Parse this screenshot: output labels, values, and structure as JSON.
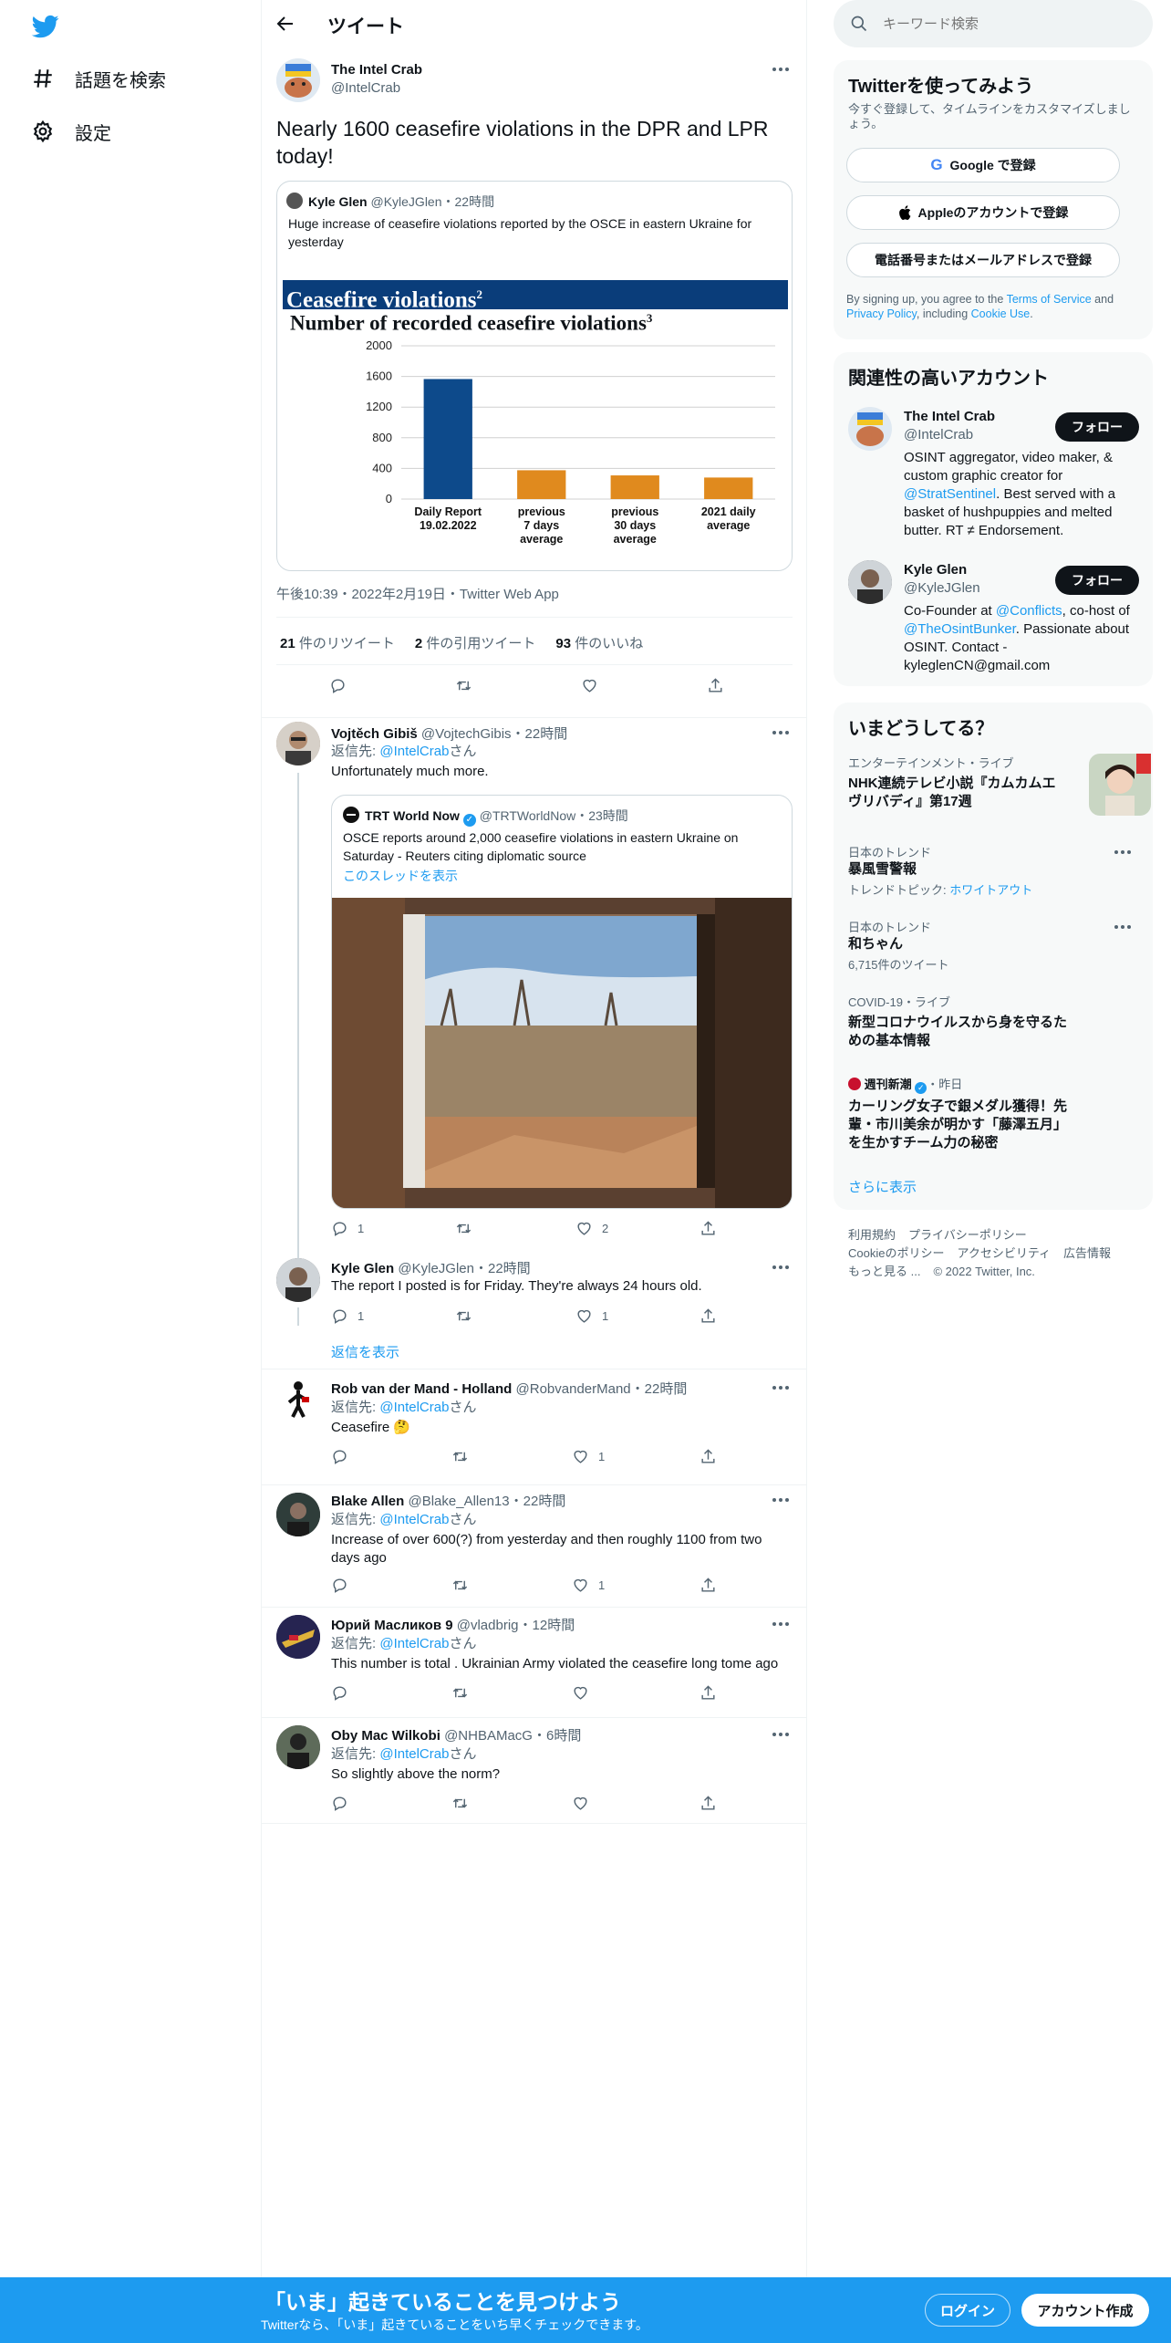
{
  "nav": {
    "explore_label": "話題を検索",
    "settings_label": "設定"
  },
  "header": {
    "title": "ツイート"
  },
  "tweet": {
    "author_name": "The Intel Crab",
    "author_handle": "@IntelCrab",
    "text": "Nearly 1600 ceasefire violations in the DPR and LPR today!",
    "quoted": {
      "author_name": "Kyle Glen",
      "author_handle": "@KyleJGlen",
      "time": "22時間",
      "text": "Huge increase of ceasefire violations reported by the OSCE in eastern Ukraine for yesterday",
      "image_banner": "Ceasefire violations",
      "image_banner_sup": "2",
      "image_subtitle": "Number of recorded ceasefire violations",
      "image_subtitle_sup": "3"
    },
    "meta": "午後10:39・2022年2月19日・Twitter Web App",
    "stats": {
      "retweets_count": "21",
      "retweets_label": " 件のリツイート",
      "quotes_count": "2",
      "quotes_label": " 件の引用ツイート",
      "likes_count": "93",
      "likes_label": " 件のいいね"
    }
  },
  "chart_data": {
    "type": "bar",
    "title": "Number of recorded ceasefire violations",
    "categories": [
      "Daily Report\n19.02.2022",
      "previous\n7 days\naverage",
      "previous\n30 days\naverage",
      "2021 daily\naverage"
    ],
    "category_lines": [
      [
        "Daily Report",
        "19.02.2022"
      ],
      [
        "previous",
        "7 days",
        "average"
      ],
      [
        "previous",
        "30 days",
        "average"
      ],
      [
        "2021 daily",
        "average"
      ]
    ],
    "values": [
      1566,
      376,
      309,
      281
    ],
    "colors": [
      "#0d4a8b",
      "#e08a1e",
      "#e08a1e",
      "#e08a1e"
    ],
    "yticks": [
      "2000",
      "1600",
      "1200",
      "800",
      "400",
      "0"
    ],
    "ylim": [
      0,
      2000
    ],
    "grid": true
  },
  "replies": [
    {
      "name": "Vojtěch Gibiš",
      "handle": "@VojtechGibis",
      "time": "22時間",
      "reply_prefix": "返信先: ",
      "reply_to": "@IntelCrab",
      "reply_suffix": "さん",
      "text": "Unfortunately much more.",
      "embed": {
        "name": "TRT World Now",
        "handle": "@TRTWorldNow",
        "time": "23時間",
        "text": "OSCE reports around 2,000 ceasefire violations in eastern Ukraine on Saturday - Reuters citing diplomatic source",
        "thread_link": "このスレッドを表示"
      },
      "reply_count": "1",
      "retweet_count": "",
      "like_count": "2"
    },
    {
      "name": "Kyle Glen",
      "handle": "@KyleJGlen",
      "time": "22時間",
      "text": "The report I posted is for Friday. They're always 24 hours old.",
      "reply_count": "1",
      "retweet_count": "",
      "like_count": "1",
      "show_replies": "返信を表示"
    },
    {
      "name": "Rob van der Mand - Holland",
      "handle": "@RobvanderMand",
      "time": "22時間",
      "reply_prefix": "返信先: ",
      "reply_to": "@IntelCrab",
      "reply_suffix": "さん",
      "text": "Ceasefire 🤔",
      "reply_count": "",
      "retweet_count": "",
      "like_count": "1"
    },
    {
      "name": "Blake Allen",
      "handle": "@Blake_Allen13",
      "time": "22時間",
      "reply_prefix": "返信先: ",
      "reply_to": "@IntelCrab",
      "reply_suffix": "さん",
      "text": "Increase of over 600(?) from yesterday and then roughly 1100 from two days ago",
      "reply_count": "",
      "retweet_count": "",
      "like_count": "1"
    },
    {
      "name": "Юрий Масликов 9",
      "handle": "@vladbrig",
      "time": "12時間",
      "reply_prefix": "返信先: ",
      "reply_to": "@IntelCrab",
      "reply_suffix": "さん",
      "text": "This number is total . Ukrainian Army violated the ceasefire long tome ago",
      "reply_count": "",
      "retweet_count": "",
      "like_count": ""
    },
    {
      "name": "Oby Mac Wilkobi",
      "handle": "@NHBAMacG",
      "time": "6時間",
      "reply_prefix": "返信先: ",
      "reply_to": "@IntelCrab",
      "reply_suffix": "さん",
      "text": "So slightly above the norm?",
      "reply_count": "",
      "retweet_count": "",
      "like_count": ""
    }
  ],
  "search": {
    "placeholder": "キーワード検索"
  },
  "signup": {
    "title": "Twitterを使ってみよう",
    "subtitle": "今すぐ登録して、タイムラインをカスタマイズしましょう。",
    "google": "Google で登録",
    "apple": "Appleのアカウントで登録",
    "phone": "電話番号またはメールアドレスで登録",
    "legal_1": "By signing up, you agree to the ",
    "tos": "Terms of Service",
    "legal_2": " and ",
    "privacy": "Privacy Policy",
    "legal_3": ", including ",
    "cookie": "Cookie Use",
    "legal_4": "."
  },
  "related": {
    "title": "関連性の高いアカウント",
    "follow_label": "フォロー",
    "accounts": [
      {
        "name": "The Intel Crab",
        "handle": "@IntelCrab",
        "bio_1": "OSINT aggregator, video maker, & custom graphic creator for ",
        "bio_link": "@StratSentinel",
        "bio_2": ". Best served with a basket of hushpuppies and melted butter. RT ≠ Endorsement."
      },
      {
        "name": "Kyle Glen",
        "handle": "@KyleJGlen",
        "bio_1": "Co-Founder at ",
        "bio_link": "@Conflicts",
        "bio_2": ", co-host of ",
        "bio_link2": "@TheOsintBunker",
        "bio_3": ". Passionate about OSINT. Contact - kyleglenCN@gmail.com"
      }
    ]
  },
  "trends": {
    "title": "いまどうしてる？",
    "items": [
      {
        "category": "エンターテインメント・ライブ",
        "title": "NHK連続テレビ小説『カムカムエヴリバディ』第17週"
      },
      {
        "category": "日本のトレンド",
        "title": "暴風雪警報",
        "extra_prefix": "トレンドトピック: ",
        "extra_link": "ホワイトアウト"
      },
      {
        "category": "日本のトレンド",
        "title": "和ちゃん",
        "extra": "6,715件のツイート"
      },
      {
        "category": "COVID-19・ライブ",
        "title": "新型コロナウイルスから身を守るための基本情報"
      },
      {
        "source": "週刊新潮",
        "time": "・昨日",
        "title": "カーリング女子で銀メダル獲得！先輩・市川美余が明かす「藤澤五月」を生かすチーム力の秘密"
      }
    ],
    "more": "さらに表示"
  },
  "footer": {
    "line1": [
      "利用規約",
      "プライバシーポリシー"
    ],
    "line2": [
      "Cookieのポリシー",
      "アクセシビリティ",
      "広告情報"
    ],
    "more": "もっと見る ...",
    "copyright": "© 2022 Twitter, Inc."
  },
  "bottom": {
    "title": "「いま」起きていることを見つけよう",
    "subtitle": "Twitterなら、「いま」起きていることをいち早くチェックできます。",
    "login": "ログイン",
    "signup": "アカウント作成"
  },
  "colors": {
    "accent": "#1d9bf0",
    "text": "#0f1419",
    "muted": "#536471",
    "chart_banner": "#0a3d7a"
  }
}
